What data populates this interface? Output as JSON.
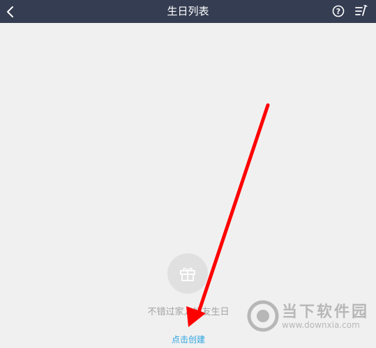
{
  "header": {
    "title": "生日列表",
    "back_icon": "chevron-left-icon",
    "help_icon": "question-circle-icon",
    "edit_icon": "list-edit-icon",
    "background": "#353d52"
  },
  "empty_state": {
    "icon": "gift-icon",
    "message": "不错过家人好友生日",
    "action_label": "点击创建",
    "action_color": "#2aa3e0"
  },
  "annotation": {
    "type": "arrow",
    "color": "#ff0000"
  },
  "watermark": {
    "name": "当下软件园",
    "url": "www.downxia.com"
  }
}
